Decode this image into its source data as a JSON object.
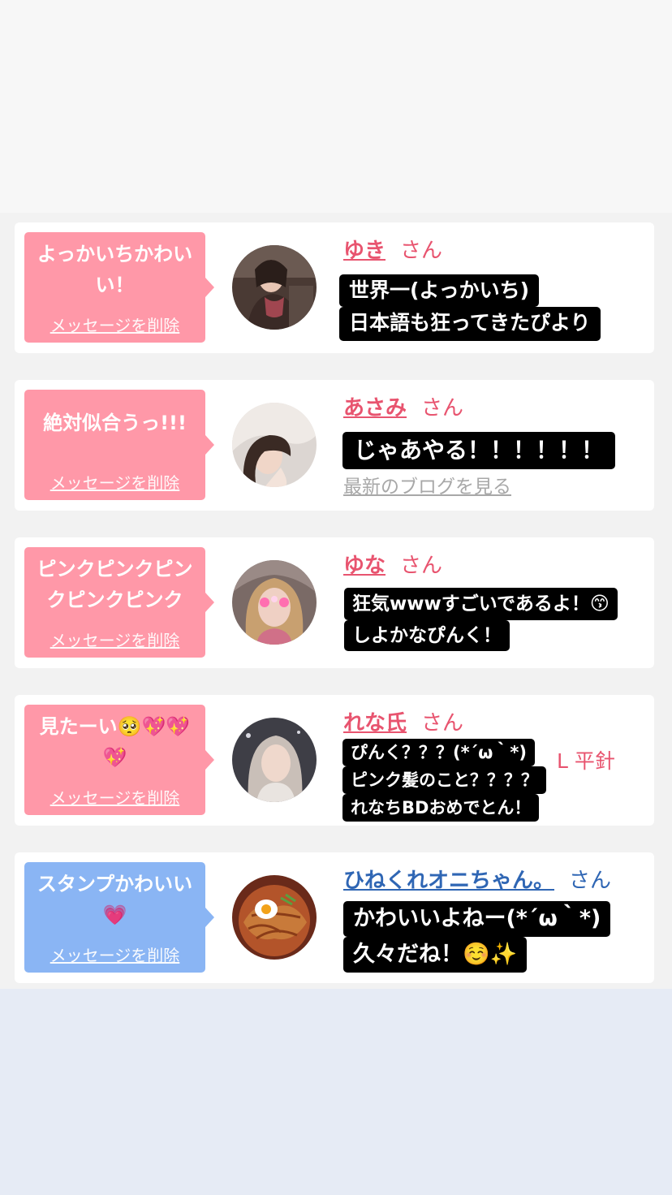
{
  "cards": [
    {
      "bubble_color": "pink",
      "message": "よっかいちかわいい！",
      "delete_label": "メッセージを削除",
      "name": "ゆき",
      "honorific": "さん",
      "stickers": [
        "世界一(よっかいち)",
        "日本語も狂ってきたぴより"
      ]
    },
    {
      "bubble_color": "pink",
      "message": "絶対似合うっ!!!",
      "delete_label": "メッセージを削除",
      "name": "あさみ",
      "honorific": "さん",
      "blog_link": "最新のブログを見る",
      "stickers": [
        "じゃあやる！！！！！！"
      ]
    },
    {
      "bubble_color": "pink",
      "message": "ピンクピンクピンクピンクピンク",
      "delete_label": "メッセージを削除",
      "name": "ゆな",
      "honorific": "さん",
      "stickers": [
        "狂気wwwすごいであるよ！😙",
        "しよかなぴんく！"
      ]
    },
    {
      "bubble_color": "pink",
      "message": "見たーい🥺💖💖💖",
      "delete_label": "メッセージを削除",
      "name": "れな氏",
      "honorific": "さん",
      "peek_text": "L 平針",
      "stickers": [
        "ぴんく？？？(*´ω｀*)",
        "ピンク髪のこと？？？？",
        "れなちBDおめでとん！"
      ]
    },
    {
      "bubble_color": "blue",
      "message": "スタンプかわいい💗",
      "delete_label": "メッセージを削除",
      "name": "ひねくれオニちゃん。",
      "honorific": "さん",
      "stickers": [
        "かわいいよねー(*´ω｀*)",
        "久々だね！☺️✨"
      ]
    }
  ],
  "colors": {
    "bubble_pink": "#ff98a8",
    "bubble_blue": "#8ab5f4",
    "name_pink": "#e8546f",
    "name_blue": "#2f66b4",
    "sticker_bg": "#000000",
    "page_bg": "#f2f2f2"
  }
}
